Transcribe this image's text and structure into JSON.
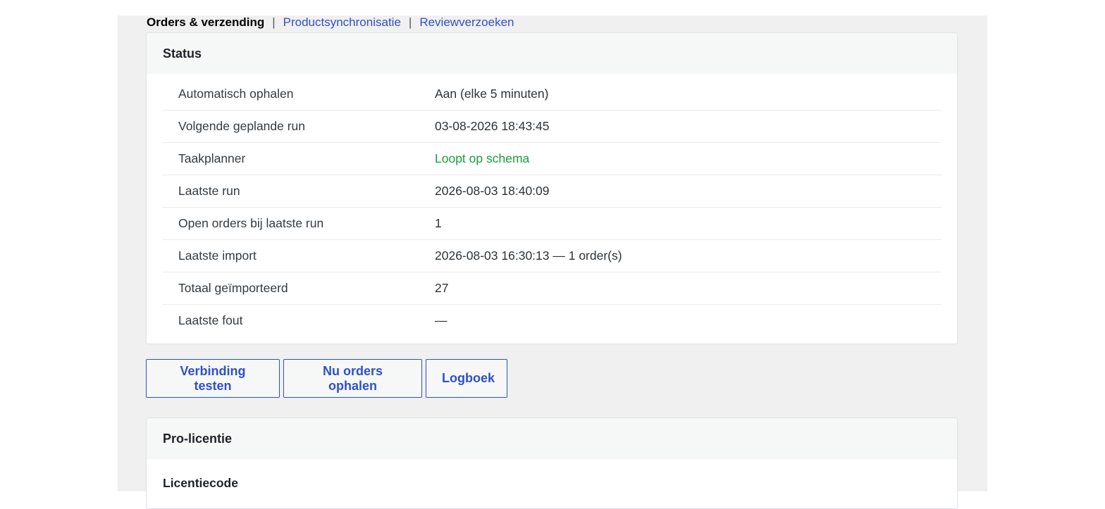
{
  "subnav": {
    "current": "Orders & verzending",
    "separator": "|",
    "links": [
      "Productsynchronisatie",
      "Reviewverzoeken"
    ]
  },
  "status": {
    "title": "Status",
    "rows": [
      {
        "label": "Automatisch ophalen",
        "value": "Aan (elke 5 minuten)"
      },
      {
        "label": "Volgende geplande run",
        "value": "03-08-2026 18:43:45"
      },
      {
        "label": "Taakplanner",
        "value": "Loopt op schema"
      },
      {
        "label": "Laatste run",
        "value": "2026-08-03 18:40:09"
      },
      {
        "label": "Open orders bij laatste run",
        "value": "1"
      },
      {
        "label": "Laatste import",
        "value": "2026-08-03 16:30:13 — 1 order(s)"
      },
      {
        "label": "Totaal geïmporteerd",
        "value": "27"
      },
      {
        "label": "Laatste fout",
        "value": "—"
      }
    ]
  },
  "actions": {
    "test_connection": "Verbinding testen",
    "fetch_orders": "Nu orders ophalen",
    "log": "Logboek"
  },
  "pro_license": {
    "title": "Pro-licentie",
    "license_code_label": "Licentiecode"
  },
  "colors": {
    "link": "#2f51c9",
    "ok": "#1a9c3c",
    "page_bg": "#f0f0f1"
  }
}
